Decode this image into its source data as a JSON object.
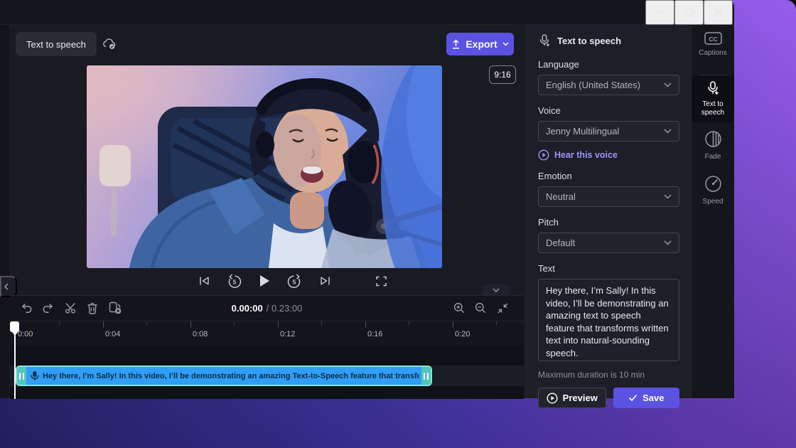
{
  "header": {
    "chip": "Text to speech",
    "export_label": "Export"
  },
  "preview": {
    "aspect_badge": "9:16"
  },
  "transport": {
    "skip_seconds": "5"
  },
  "timeline": {
    "time_current": "0.00:00",
    "time_total": "/ 0.23:00",
    "ruler": [
      "0:00",
      "0:04",
      "0:08",
      "0:12",
      "0:16",
      "0:20"
    ],
    "clip_text": "Hey there, I’m Sally! In this video, I’ll be demonstrating an amazing Text-to-Speech feature that transforms w"
  },
  "panel": {
    "title": "Text to speech",
    "language_label": "Language",
    "language_value": "English (United States)",
    "voice_label": "Voice",
    "voice_value": "Jenny Multilingual",
    "hear_voice": "Hear this voice",
    "emotion_label": "Emotion",
    "emotion_value": "Neutral",
    "pitch_label": "Pitch",
    "pitch_value": "Default",
    "text_label": "Text",
    "text_value": "Hey there, I’m Sally! In this video, I’ll be demonstrating an amazing text to speech feature that transforms written text into natural-sounding speech.",
    "max_duration": "Maximum duration is 10 min",
    "preview_button": "Preview",
    "save_button": "Save"
  },
  "tabs": [
    {
      "id": "captions",
      "label": "Captions",
      "active": false
    },
    {
      "id": "text-to-speech",
      "label": "Text to speech",
      "active": true
    },
    {
      "id": "fade",
      "label": "Fade",
      "active": false
    },
    {
      "id": "speed",
      "label": "Speed",
      "active": false
    }
  ],
  "icons": {
    "cloud-saved": "cloud-check",
    "export": "arrow-up-upload",
    "transport": [
      "skip-to-start",
      "rewind-5",
      "play",
      "forward-5",
      "skip-to-end",
      "fullscreen"
    ],
    "timeline_toolbar": [
      "undo",
      "redo",
      "cut-scissors",
      "delete-trash",
      "duplicate",
      "zoom-in",
      "zoom-out",
      "fit-to-screen"
    ],
    "tabs": [
      "captions-cc",
      "mic-sparkle",
      "fade-circle",
      "speed-gauge"
    ],
    "misc": [
      "chevron-down",
      "chevron-left",
      "play-circle",
      "checkmark",
      "mic"
    ]
  },
  "colors": {
    "accent": "#5a52e0",
    "clip_blue": "#2f9ef4",
    "clip_border": "#7ee7d8",
    "link_purple": "#9b97f8"
  }
}
